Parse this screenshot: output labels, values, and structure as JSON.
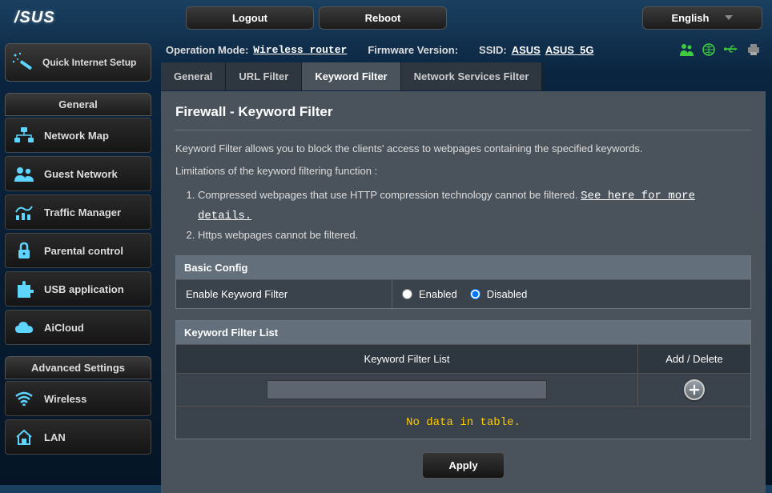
{
  "brand": "/SUS",
  "top": {
    "logout": "Logout",
    "reboot": "Reboot",
    "language": "English"
  },
  "status": {
    "op_mode_label": "Operation Mode:",
    "op_mode_value": "Wireless router",
    "fw_label": "Firmware Version:",
    "ssid_label": "SSID:",
    "ssid1": "ASUS",
    "ssid2": "ASUS_5G"
  },
  "qis": "Quick Internet Setup",
  "sidebar": {
    "general_header": "General",
    "items_general": [
      "Network Map",
      "Guest Network",
      "Traffic Manager",
      "Parental control",
      "USB application",
      "AiCloud"
    ],
    "advanced_header": "Advanced Settings",
    "items_advanced": [
      "Wireless",
      "LAN"
    ]
  },
  "tabs": [
    "General",
    "URL Filter",
    "Keyword Filter",
    "Network Services Filter"
  ],
  "active_tab_index": 2,
  "panel": {
    "title": "Firewall - Keyword Filter",
    "desc": "Keyword Filter allows you to block the clients' access to webpages containing the specified keywords.",
    "limitations_label": "Limitations of the keyword filtering function :",
    "limit1_text": "Compressed webpages that use HTTP compression technology cannot be filtered. ",
    "limit1_link": "See here for more details.",
    "limit2": "Https webpages cannot be filtered."
  },
  "basic_config": {
    "header": "Basic Config",
    "label": "Enable Keyword Filter",
    "enabled_label": "Enabled",
    "disabled_label": "Disabled",
    "value": "disabled"
  },
  "filter_list": {
    "header": "Keyword Filter List",
    "col1": "Keyword Filter List",
    "col2": "Add / Delete",
    "input_value": "",
    "empty": "No data in table."
  },
  "apply": "Apply"
}
